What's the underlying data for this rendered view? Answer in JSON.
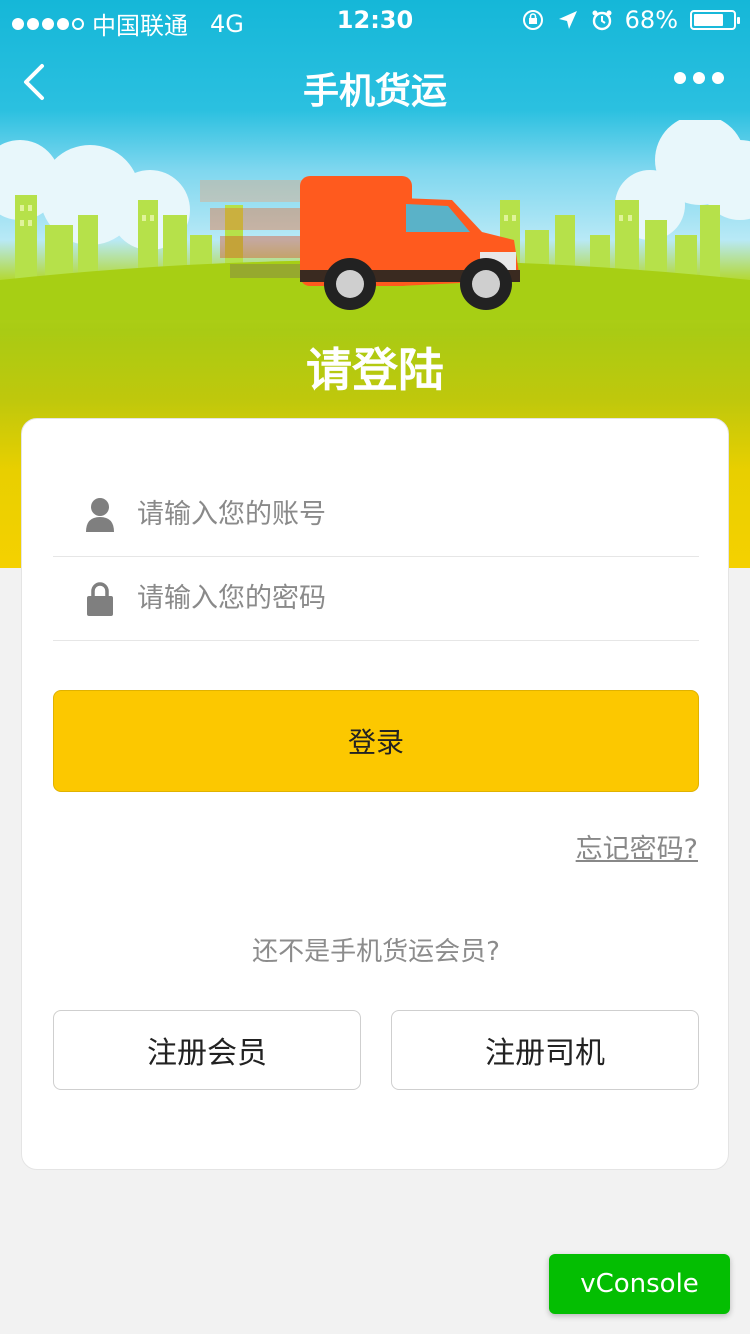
{
  "status_bar": {
    "carrier": "中国联通",
    "network": "4G",
    "time": "12:30",
    "battery": "68%",
    "battery_level": 0.68
  },
  "nav": {
    "title": "手机货运",
    "back_icon": "chevron-left-icon",
    "more_icon": "more-dots-icon"
  },
  "hero": {
    "heading": "请登陆"
  },
  "form": {
    "account_placeholder": "请输入您的账号",
    "password_placeholder": "请输入您的密码",
    "login_label": "登录",
    "forgot_label": "忘记密码?"
  },
  "register": {
    "prompt": "还不是手机货运会员?",
    "member_label": "注册会员",
    "driver_label": "注册司机"
  },
  "debug": {
    "vconsole_label": "vConsole"
  },
  "colors": {
    "accent": "#fcc800",
    "nav_bg": "#15b7d8",
    "vconsole": "#04be02"
  }
}
